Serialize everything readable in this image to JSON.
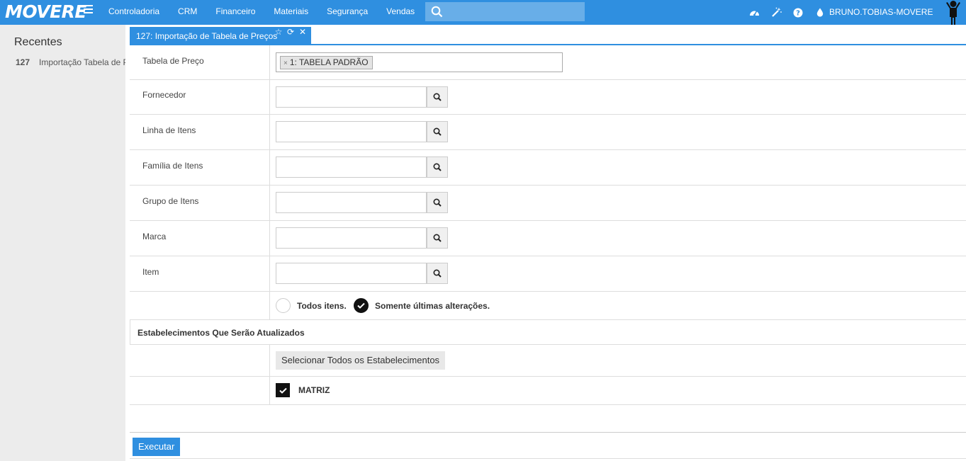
{
  "navbar": {
    "logo": "MOVERE",
    "menu": [
      "Controladoria",
      "CRM",
      "Financeiro",
      "Materiais",
      "Segurança",
      "Vendas"
    ],
    "search_placeholder": "",
    "icons": [
      "dashboard-icon",
      "magic-wand-icon",
      "help-icon",
      "drop-icon"
    ],
    "username": "BRUNO.TOBIAS-MOVERE"
  },
  "sidebar": {
    "title": "Recentes",
    "recent": [
      {
        "num": "127",
        "label": "Importação Tabela de Preços"
      }
    ]
  },
  "tab": {
    "title": "127: Importação de Tabela de Preços",
    "icons": [
      "star-icon",
      "refresh-icon",
      "close-icon"
    ]
  },
  "form": {
    "price_table": {
      "label": "Tabela de Preço",
      "tag": "1: TABELA PADRÃO",
      "tag_remove": "×"
    },
    "fields": [
      {
        "label": "Fornecedor",
        "value": ""
      },
      {
        "label": "Linha de Itens",
        "value": ""
      },
      {
        "label": "Família de Itens",
        "value": ""
      },
      {
        "label": "Grupo de Itens",
        "value": ""
      },
      {
        "label": "Marca",
        "value": ""
      },
      {
        "label": "Item",
        "value": ""
      }
    ],
    "options": {
      "all_items": "Todos itens.",
      "last_changes": "Somente últimas alterações.",
      "selected": "last_changes"
    },
    "establishments": {
      "section_title": "Estabelecimentos Que Serão Atualizados",
      "select_all": "Selecionar Todos os Estabelecimentos",
      "items": [
        {
          "label": "MATRIZ",
          "checked": true
        }
      ]
    }
  },
  "footer": {
    "execute": "Executar"
  },
  "colors": {
    "accent": "#2f8fe0",
    "sidebar_bg": "#ececec"
  }
}
